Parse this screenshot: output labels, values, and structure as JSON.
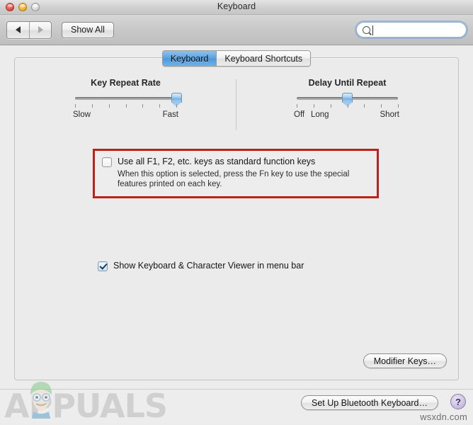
{
  "window": {
    "title": "Keyboard",
    "traffic_lights": [
      "close-button",
      "minimize-button",
      "zoom-button"
    ]
  },
  "toolbar": {
    "back_label": "◀",
    "forward_label": "▶",
    "show_all_label": "Show All",
    "search": {
      "value": "",
      "placeholder": "",
      "icon": "search-icon"
    }
  },
  "tabs": [
    {
      "label": "Keyboard",
      "active": true
    },
    {
      "label": "Keyboard Shortcuts",
      "active": false
    }
  ],
  "sliders": [
    {
      "title": "Key Repeat Rate",
      "left_label": "Slow",
      "right_label": "Fast",
      "extra_label": "",
      "ticks": 7,
      "value_index": 7,
      "max_index": 7
    },
    {
      "title": "Delay Until Repeat",
      "left_label": "Off",
      "extra_label": "Long",
      "right_label": "Short",
      "ticks": 7,
      "value_index": 4,
      "max_index": 7
    }
  ],
  "options": {
    "fn_keys": {
      "checked": false,
      "label": "Use all F1, F2, etc. keys as standard function keys",
      "description": "When this option is selected, press the Fn key to use the special features printed on each key.",
      "highlight_color": "#c0201a"
    },
    "viewer": {
      "checked": true,
      "label": "Show Keyboard & Character Viewer in menu bar"
    }
  },
  "buttons": {
    "modifier_keys": "Modifier Keys…",
    "bluetooth_keyboard": "Set Up Bluetooth Keyboard…",
    "help": "?"
  },
  "watermarks": {
    "site": "wsxdn.com",
    "brand": "APPUALS"
  }
}
